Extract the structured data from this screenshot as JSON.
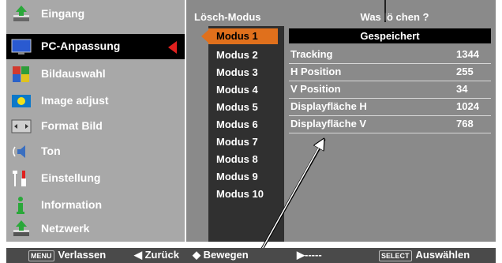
{
  "menu": {
    "items": [
      {
        "label": "Eingang",
        "icon": "input-icon"
      },
      {
        "label": "PC-Anpassung",
        "icon": "pc-adjust-icon",
        "active": true
      },
      {
        "label": "Bildauswahl",
        "icon": "image-select-icon"
      },
      {
        "label": "Image adjust",
        "icon": "image-adjust-icon"
      },
      {
        "label": "Format Bild",
        "icon": "screen-format-icon"
      },
      {
        "label": "Ton",
        "icon": "speaker-icon"
      },
      {
        "label": "Einstellung",
        "icon": "settings-icon"
      },
      {
        "label": "Information",
        "icon": "info-icon"
      },
      {
        "label": "Netzwerk",
        "icon": "network-icon"
      }
    ]
  },
  "panel": {
    "header_left": "Lösch-Modus",
    "header_right": "Was lö chen ?",
    "modes": [
      "Modus 1",
      "Modus 2",
      "Modus 3",
      "Modus 4",
      "Modus 5",
      "Modus 6",
      "Modus 7",
      "Modus 8",
      "Modus 9",
      "Modus 10"
    ],
    "selected_mode": "Modus 1",
    "saved_label": "Gespeichert",
    "rows": [
      {
        "key": "Tracking",
        "value": "1344"
      },
      {
        "key": "H Position",
        "value": "255"
      },
      {
        "key": "V Position",
        "value": "34"
      },
      {
        "key": "Displayfläche H",
        "value": "1024"
      },
      {
        "key": "Displayfläche V",
        "value": "768"
      }
    ]
  },
  "bottom": {
    "menu_key": "MENU",
    "exit": "Verlassen",
    "back": "◀ Zurück",
    "move": "◆ Bewegen",
    "next": "▶-----",
    "select_key": "SELECT",
    "select": "Auswählen"
  },
  "colors": {
    "highlight": "#e0701c",
    "red_arrow": "#e0201e"
  }
}
